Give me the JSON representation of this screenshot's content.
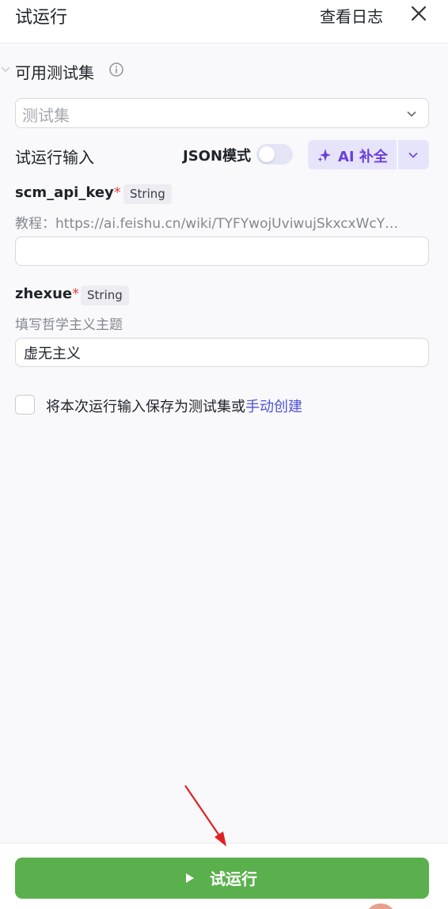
{
  "header": {
    "title": "试运行",
    "view_logs": "查看日志"
  },
  "test_set": {
    "label": "可用测试集",
    "placeholder": "测试集"
  },
  "run_input": {
    "label": "试运行输入",
    "json_mode_label": "JSON模式",
    "json_mode_on": false,
    "ai_fill_label": "AI 补全"
  },
  "params": [
    {
      "name": "scm_api_key",
      "required_mark": "*",
      "type": "String",
      "description": "教程：https://ai.feishu.cn/wiki/TYFYwojUviwujSkxcxWcY…",
      "value": ""
    },
    {
      "name": "zhexue",
      "required_mark": "*",
      "type": "String",
      "description": "填写哲学主义主题",
      "value": "虚无主义"
    }
  ],
  "save_option": {
    "text": "将本次运行输入保存为测试集或",
    "link": "手动创建"
  },
  "footer": {
    "run_label": "试运行"
  },
  "colors": {
    "accent_purple": "#6c3fd9",
    "run_green": "#5bb04e",
    "link_blue": "#4f52d6",
    "required_red": "#e54545",
    "annotation_arrow": "#e02020"
  }
}
